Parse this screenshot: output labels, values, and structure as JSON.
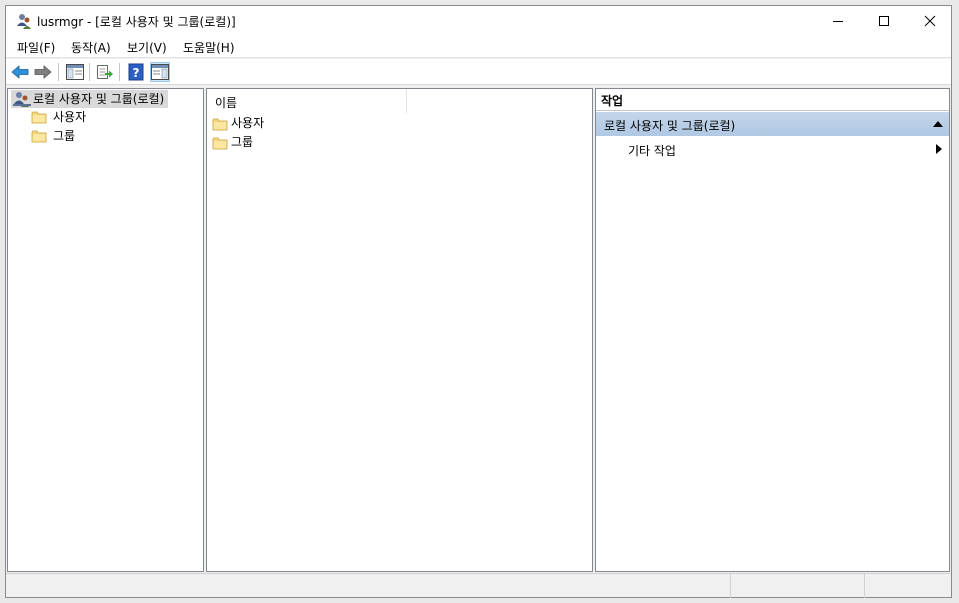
{
  "window": {
    "title": "lusrmgr - [로컬 사용자 및 그룹(로컬)]"
  },
  "menubar": {
    "items": [
      "파일(F)",
      "동작(A)",
      "보기(V)",
      "도움말(H)"
    ]
  },
  "toolbar": {
    "buttons": [
      "back-icon",
      "forward-icon",
      "show-hide-console-tree-icon",
      "export-list-icon",
      "help-icon",
      "show-hide-action-pane-icon"
    ]
  },
  "tree": {
    "root_label": "로컬 사용자 및 그룹(로컬)",
    "children": [
      "사용자",
      "그룹"
    ]
  },
  "list": {
    "column_name": "이름",
    "rows": [
      "사용자",
      "그룹"
    ]
  },
  "actions": {
    "header": "작업",
    "section_label": "로컬 사용자 및 그룹(로컬)",
    "more_actions_label": "기타 작업"
  },
  "colors": {
    "selected_tree_bg": "#d9d9d9",
    "action_section_bg": "#b0c8e3",
    "folder_yellow": "#f5d67c"
  }
}
